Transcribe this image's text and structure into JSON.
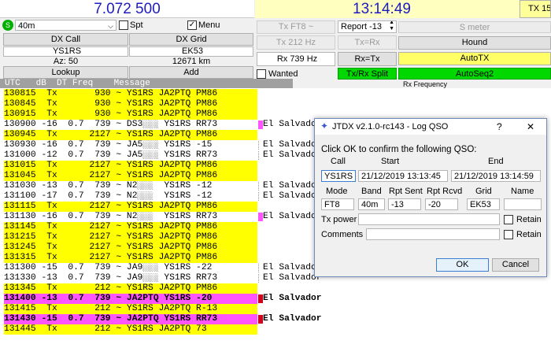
{
  "header": {
    "frequency": "7.072 500",
    "clock": "13:14:49",
    "tx_box": "TX 15",
    "status_s": "S"
  },
  "left_panel": {
    "band": "40m",
    "spt_label": "Spt",
    "menu_label": "Menu",
    "dx_call_label": "DX Call",
    "dx_grid_label": "DX Grid",
    "dx_call_value": "YS1RS",
    "dx_grid_value": "EK53",
    "azimuth": "Az: 50",
    "distance": "12671 km",
    "lookup_label": "Lookup",
    "add_label": "Add"
  },
  "mid_panel": {
    "tx_mode": "Tx FT8 ~",
    "tx_hz": "Tx  212  Hz",
    "rx_hz": "Rx  739  Hz",
    "report": "Report -13",
    "tx_eq_rx": "Tx=Rx",
    "rx_eq_tx": "Rx=Tx",
    "wanted_label": "Wanted",
    "tx_rx_split": "Tx/Rx Split"
  },
  "right_panel": {
    "s_meter": "S meter",
    "hound": "Hound",
    "auto_tx": "AutoTX",
    "auto_seq": "AutoSeq2",
    "rx_frequency": "Rx Frequency"
  },
  "list_header": "UTC   dB  DT Freq    Message",
  "messages": [
    {
      "text": "130815  Tx       930 ~ YS1RS JA2PTQ PM86",
      "bg": "y",
      "country": ""
    },
    {
      "text": "130845  Tx       930 ~ YS1RS JA2PTQ PM86",
      "bg": "y",
      "country": ""
    },
    {
      "text": "130915  Tx       930 ~ YS1RS JA2PTQ PM86",
      "bg": "y",
      "country": ""
    },
    {
      "text": "130900 -16  0.7  739 ~ DS3░░░ YS1RS RR73",
      "bg": "",
      "country": "El Salvador",
      "mark": "m"
    },
    {
      "text": "130945  Tx      2127 ~ YS1RS JA2PTQ PM86",
      "bg": "y",
      "country": ""
    },
    {
      "text": "130930 -16  0.7  739 ~ JA5░░░ YS1RS -15",
      "bg": "",
      "country": "El Salvador",
      "mark": "w"
    },
    {
      "text": "131000 -12  0.7  739 ~ JA5░░░ YS1RS RR73",
      "bg": "",
      "country": "El Salvador",
      "mark": "w"
    },
    {
      "text": "131015  Tx      2127 ~ YS1RS JA2PTQ PM86",
      "bg": "y",
      "country": ""
    },
    {
      "text": "131045  Tx      2127 ~ YS1RS JA2PTQ PM86",
      "bg": "y",
      "country": ""
    },
    {
      "text": "131030 -13  0.7  739 ~ N2░░░  YS1RS -12",
      "bg": "",
      "country": "El Salvador",
      "mark": "w"
    },
    {
      "text": "131100 -17  0.7  739 ~ N2░░░  YS1RS -12",
      "bg": "",
      "country": "El Salvador",
      "mark": "w"
    },
    {
      "text": "131115  Tx      2127 ~ YS1RS JA2PTQ PM86",
      "bg": "y",
      "country": ""
    },
    {
      "text": "131130 -16  0.7  739 ~ N2░░░  YS1RS RR73",
      "bg": "",
      "country": "El Salvador",
      "mark": "m"
    },
    {
      "text": "131145  Tx      2127 ~ YS1RS JA2PTQ PM86",
      "bg": "y",
      "country": ""
    },
    {
      "text": "131215  Tx      2127 ~ YS1RS JA2PTQ PM86",
      "bg": "y",
      "country": ""
    },
    {
      "text": "131245  Tx      2127 ~ YS1RS JA2PTQ PM86",
      "bg": "y",
      "country": ""
    },
    {
      "text": "131315  Tx      2127 ~ YS1RS JA2PTQ PM86",
      "bg": "y",
      "country": ""
    },
    {
      "text": "131300 -15  0.7  739 ~ JA9░░░ YS1RS -22",
      "bg": "",
      "country": "El Salvador",
      "mark": "w"
    },
    {
      "text": "131330 -13  0.7  739 ~ JA9░░░ YS1RS RR73",
      "bg": "",
      "country": "El Salvador",
      "mark": "w"
    },
    {
      "text": "131345  Tx       212 ~ YS1RS JA2PTQ PM86",
      "bg": "y",
      "country": ""
    },
    {
      "text": "131400 -13  0.7  739 ~ JA2PTQ YS1RS -20",
      "bg": "m",
      "country": "El Salvador",
      "mark": "r",
      "bold": true
    },
    {
      "text": "131415  Tx       212 ~ YS1RS JA2PTQ R-13",
      "bg": "y",
      "country": ""
    },
    {
      "text": "131430 -15  0.7  739 ~ JA2PTQ YS1RS RR73",
      "bg": "m",
      "country": "El Salvador",
      "mark": "r",
      "bold": true
    },
    {
      "text": "131445  Tx       212 ~ YS1RS JA2PTQ 73",
      "bg": "y",
      "country": ""
    }
  ],
  "dialog": {
    "title": "JTDX v2.1.0-rc143 - Log QSO",
    "help": "?",
    "close": "✕",
    "prompt": "Click OK to confirm the following QSO:",
    "call_label": "Call",
    "start_label": "Start",
    "end_label": "End",
    "call_value": "YS1RS",
    "start_value": "21/12/2019 13:13:45",
    "end_value": "21/12/2019 13:14:59",
    "mode_label": "Mode",
    "band_label": "Band",
    "rpt_sent_label": "Rpt Sent",
    "rpt_rcvd_label": "Rpt Rcvd",
    "grid_label": "Grid",
    "name_label": "Name",
    "mode_value": "FT8",
    "band_value": "40m",
    "rpt_sent_value": "-13",
    "rpt_rcvd_value": "-20",
    "grid_value": "EK53",
    "name_value": "",
    "tx_power_label": "Tx power",
    "comments_label": "Comments",
    "retain_label": "Retain",
    "ok_label": "OK",
    "cancel_label": "Cancel"
  },
  "colors": {
    "frequency_text": "#1c1cc0",
    "tx_row": "#ffff00",
    "my_call_row": "#ff55ff",
    "split_button": "#00d800"
  }
}
